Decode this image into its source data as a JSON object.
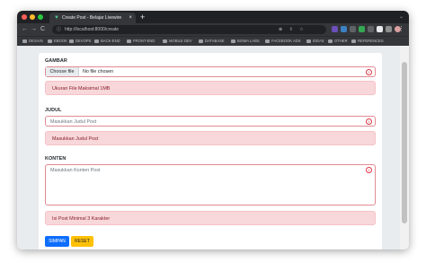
{
  "browser": {
    "tab_title": "Create Post - Belajar Livewire",
    "tab_close": "×",
    "new_tab": "+",
    "url": "http://localhost:8000/create",
    "back": "←",
    "forward": "→",
    "reload": "C",
    "lock": "ⓘ",
    "omni_actions": "⊕ ⇪ ☆",
    "menu": "⋮",
    "tab_menu": "⌄",
    "bookmarks": [
      "DESAIN",
      "EBOOK",
      "DEVOPS",
      "BACK-END",
      "FRONT-END",
      "MOBILE DEV",
      "DATABASE",
      "BISMA LABS",
      "FACEBOOK ADS",
      "IDEAS",
      "OTHER",
      "REFERENCES"
    ],
    "colors": {
      "titlebar": "#202124",
      "toolbar": "#35363a"
    }
  },
  "form": {
    "gambar": {
      "label": "GAMBAR",
      "button": "Choose file",
      "file_text": "No file chosen",
      "error": "Ukuran File Maksimal 1MB"
    },
    "judul": {
      "label": "JUDUL",
      "placeholder": "Masukkan Judul Post",
      "error": "Masukkan Judul Post"
    },
    "konten": {
      "label": "KONTEN",
      "placeholder": "Masukkan Konten Post",
      "error": "Isi Post Minimal 3 Karakter"
    },
    "error_icon": "!",
    "buttons": {
      "submit": "SIMPAN",
      "reset": "RESET"
    },
    "colors": {
      "primary": "#0d6efd",
      "warning": "#ffc107",
      "danger": "#dc3545",
      "alert_bg": "#f8d7da",
      "alert_text": "#842029"
    }
  }
}
